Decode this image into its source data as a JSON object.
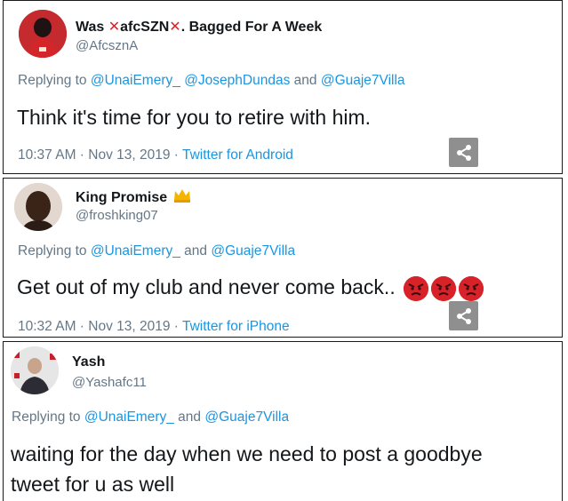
{
  "tweets": [
    {
      "name_prefix": "Was ",
      "name_x1": "✕",
      "name_mid": "afcSZN",
      "name_x2": "✕",
      "name_suffix": ". Bagged For A Week",
      "handle": "@AfcsznA",
      "reply_prefix": "Replying to ",
      "reply_mentions": [
        "@UnaiEmery_",
        "@JosephDundas",
        "@Guaje7Villa"
      ],
      "reply_sep": [
        " ",
        " and "
      ],
      "text": "Think it's time for you to retire with him.",
      "timestamp": "10:37 AM · Nov 13, 2019 · ",
      "source": "Twitter for Android"
    },
    {
      "name": "King Promise",
      "name_badge": "crown-emoji",
      "handle": "@froshking07",
      "reply_prefix": "Replying to ",
      "reply_mentions": [
        "@UnaiEmery_",
        "@Guaje7Villa"
      ],
      "reply_sep": [
        " and "
      ],
      "text": "Get out of my club and never come back.. ",
      "emojis": [
        "angry-face",
        "angry-face",
        "angry-face"
      ],
      "timestamp": "10:32 AM · Nov 13, 2019 · ",
      "source": "Twitter for iPhone"
    },
    {
      "name": "Yash",
      "handle": "@Yashafc11",
      "reply_prefix": "Replying to ",
      "reply_mentions": [
        "@UnaiEmery_",
        "@Guaje7Villa"
      ],
      "reply_sep": [
        " and "
      ],
      "text_line1": "waiting for the day when we need to post a goodbye",
      "text_line2": "tweet for u as well"
    }
  ],
  "colors": {
    "link": "#1b95e0",
    "muted": "#657786",
    "text": "#14171a",
    "red_x": "#d6252b",
    "share_bg": "#8f8f8f"
  },
  "icons": {
    "share": "share-icon"
  }
}
